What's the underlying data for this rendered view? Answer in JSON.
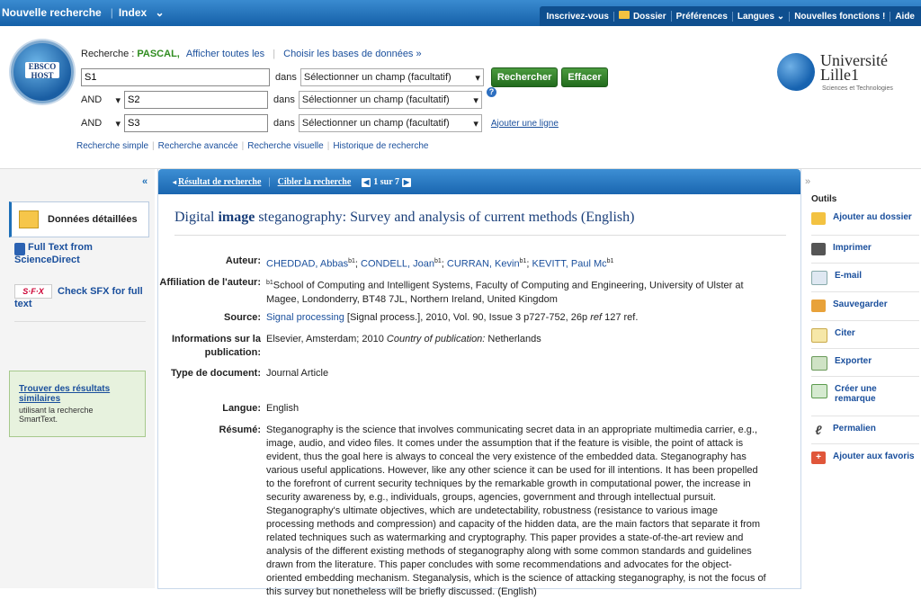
{
  "topbar": {
    "new_search": "Nouvelle recherche",
    "index": "Index",
    "right": [
      "Inscrivez-vous",
      "Dossier",
      "Préférences",
      "Langues",
      "Nouvelles fonctions !",
      "Aide"
    ]
  },
  "search": {
    "prefix": "Recherche : ",
    "database": "PASCAL,",
    "show_all": "Afficher toutes les",
    "choose_db": "Choisir les bases de données »",
    "rows": [
      {
        "bool": "",
        "value": "S1",
        "field": "Sélectionner un champ (facultatif)"
      },
      {
        "bool": "AND",
        "value": "S2",
        "field": "Sélectionner un champ (facultatif)"
      },
      {
        "bool": "AND",
        "value": "S3",
        "field": "Sélectionner un champ (facultatif)"
      }
    ],
    "dans": "dans",
    "search_button": "Rechercher",
    "clear_button": "Effacer",
    "add_line": "Ajouter une ligne",
    "links": [
      "Recherche simple",
      "Recherche avancée",
      "Recherche visuelle",
      "Historique de recherche"
    ]
  },
  "logo": {
    "ebsco": "EBSCO HOST"
  },
  "university": {
    "name1": "Université",
    "name2": "Lille1",
    "sub": "Sciences et Technologies"
  },
  "left": {
    "collapse": "«",
    "detail": "Données détaillées",
    "fulltext": "Full Text from ScienceDirect",
    "sfx_icon": "S·F·X",
    "sfx": "Check SFX for full text",
    "similar_title": "Trouver des résultats similaires",
    "similar_desc": "utilisant la recherche SmartText."
  },
  "result": {
    "back": "Résultat de recherche",
    "refine": "Cibler la recherche",
    "pager": "1 sur 7",
    "title_pre": "Digital ",
    "title_bold": "image",
    "title_post": " steganography: Survey and analysis of current methods (English)"
  },
  "fields": {
    "author_label": "Auteur:",
    "authors": [
      "CHEDDAD, Abbas",
      "CONDELL, Joan",
      "CURRAN, Kevin",
      "KEVITT, Paul Mc"
    ],
    "author_sup": "b1",
    "affil_label": "Affiliation de l'auteur:",
    "affil_sup": "b1",
    "affil": "School of Computing and Intelligent Systems, Faculty of Computing and Engineering, University of Ulster at Magee, Londonderry, BT48 7JL, Northern Ireland, United Kingdom",
    "source_label": "Source:",
    "source_link": "Signal processing",
    "source_rest": " [Signal process.], 2010, Vol. 90, Issue 3 p727-752, 26p ",
    "source_ref_italic": "ref",
    "source_ref": " 127 ref.",
    "pubinfo_label": "Informations sur la publication:",
    "pubinfo": "Elsevier, Amsterdam; 2010 ",
    "pubinfo_italic": "Country of publication:",
    "pubinfo_country": " Netherlands",
    "doctype_label": "Type de document:",
    "doctype": "Journal Article",
    "lang_label": "Langue:",
    "lang": "English",
    "abstract_label": "Résumé:",
    "abstract": "Steganography is the science that involves communicating secret data in an appropriate multimedia carrier, e.g., image, audio, and video files. It comes under the assumption that if the feature is visible, the point of attack is evident, thus the goal here is always to conceal the very existence of the embedded data. Steganography has various useful applications. However, like any other science it can be used for ill intentions. It has been propelled to the forefront of current security techniques by the remarkable growth in computational power, the increase in security awareness by, e.g., individuals, groups, agencies, government and through intellectual pursuit. Steganography's ultimate objectives, which are undetectability, robustness (resistance to various image processing methods and compression) and capacity of the hidden data, are the main factors that separate it from related techniques such as watermarking and cryptography. This paper provides a state-of-the-art review and analysis of the different existing methods of steganography along with some common standards and guidelines drawn from the literature. This paper concludes with some recommendations and advocates for the object-oriented embedding mechanism. Steganalysis, which is the science of attacking steganography, is not the focus of this survey but nonetheless will be briefly discussed. (English)"
  },
  "right": {
    "expand": "»",
    "tools": "Outils",
    "items": [
      "Ajouter au dossier",
      "Imprimer",
      "E-mail",
      "Sauvegarder",
      "Citer",
      "Exporter",
      "Créer une remarque",
      "Permalien",
      "Ajouter aux favoris"
    ]
  }
}
